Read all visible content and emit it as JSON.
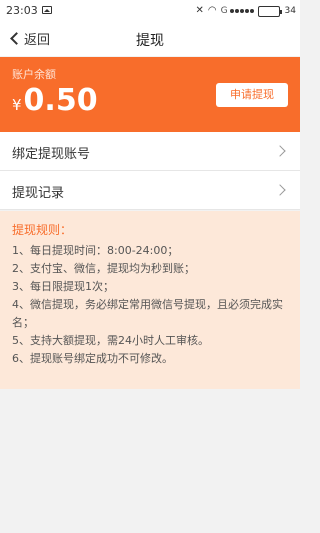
{
  "status_bar": {
    "time": "23:03",
    "network_letter": "G",
    "battery": "34"
  },
  "nav": {
    "back_label": "返回",
    "title": "提现"
  },
  "balance": {
    "caption": "账户余额",
    "currency": "¥",
    "value": "0.50",
    "apply_button": "申请提现"
  },
  "list": {
    "items": [
      {
        "label": "绑定提现账号"
      },
      {
        "label": "提现记录"
      }
    ]
  },
  "rules": {
    "title": "提现规则：",
    "items": [
      "1、每日提现时间：8:00-24:00；",
      "2、支付宝、微信，提现均为秒到账；",
      "3、每日限提现1次；",
      "4、微信提现，务必绑定常用微信号提现，且必须完成实名；",
      "5、支持大额提现，需24小时人工审核。",
      "6、提现账号绑定成功不可修改。"
    ]
  },
  "colors": {
    "accent": "#f86d2b",
    "rules_bg": "#fde8d9",
    "page_bg": "#f2f2f2"
  }
}
